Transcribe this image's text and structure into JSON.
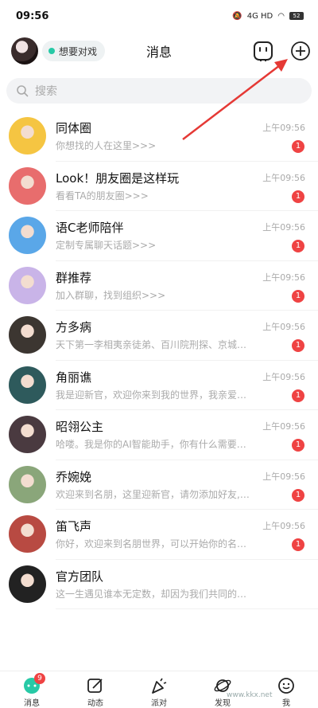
{
  "status_bar": {
    "time": "09:56",
    "network": "4G HD",
    "battery": "52"
  },
  "header": {
    "title": "消息",
    "mood": "想要对戏"
  },
  "search": {
    "placeholder": "搜索"
  },
  "conversations": [
    {
      "name": "同体圈",
      "preview": "你想找的人在这里>>>",
      "time": "上午09:56",
      "unread": "1",
      "avatar_color": "#f5c542"
    },
    {
      "name": "Look！朋友圈是这样玩",
      "preview": "看看TA的朋友圈>>>",
      "time": "上午09:56",
      "unread": "1",
      "avatar_color": "#e86d6d"
    },
    {
      "name": "语C老师陪伴",
      "preview": "定制专属聊天话题>>>",
      "time": "上午09:56",
      "unread": "1",
      "avatar_color": "#5aa7e8"
    },
    {
      "name": "群推荐",
      "preview": "加入群聊，找到组织>>>",
      "time": "上午09:56",
      "unread": "1",
      "avatar_color": "#c9b4e8"
    },
    {
      "name": "方多病",
      "preview": "天下第一李相夷亲徒弟、百川院刑探、京城…",
      "time": "上午09:56",
      "unread": "1",
      "avatar_color": "#3c3631"
    },
    {
      "name": "角丽谯",
      "preview": "我是迎新官，欢迎你来到我的世界，我亲爱…",
      "time": "上午09:56",
      "unread": "1",
      "avatar_color": "#2e5a5c"
    },
    {
      "name": "昭翎公主",
      "preview": "哈喽。我是你的AI智能助手，你有什么需要…",
      "time": "上午09:56",
      "unread": "1",
      "avatar_color": "#4a3a40"
    },
    {
      "name": "乔婉娩",
      "preview": "欢迎来到名朋，这里迎新官，请勿添加好友,…",
      "time": "上午09:56",
      "unread": "1",
      "avatar_color": "#8aa67a"
    },
    {
      "name": "笛飞声",
      "preview": "你好，欢迎来到名朋世界，可以开始你的名…",
      "time": "上午09:56",
      "unread": "1",
      "avatar_color": "#b84a42"
    },
    {
      "name": "官方团队",
      "preview": "这一生遇见谁本无定数，却因为我们共同的…",
      "time": "",
      "unread": "",
      "avatar_color": "#222222"
    }
  ],
  "tabs": [
    {
      "label": "消息",
      "badge": "9"
    },
    {
      "label": "动态",
      "badge": ""
    },
    {
      "label": "派对",
      "badge": ""
    },
    {
      "label": "发现",
      "badge": ""
    },
    {
      "label": "我",
      "badge": ""
    }
  ],
  "watermark": "www.kkx.net",
  "accent": "#27c9a6",
  "badge_color": "#ef4343"
}
